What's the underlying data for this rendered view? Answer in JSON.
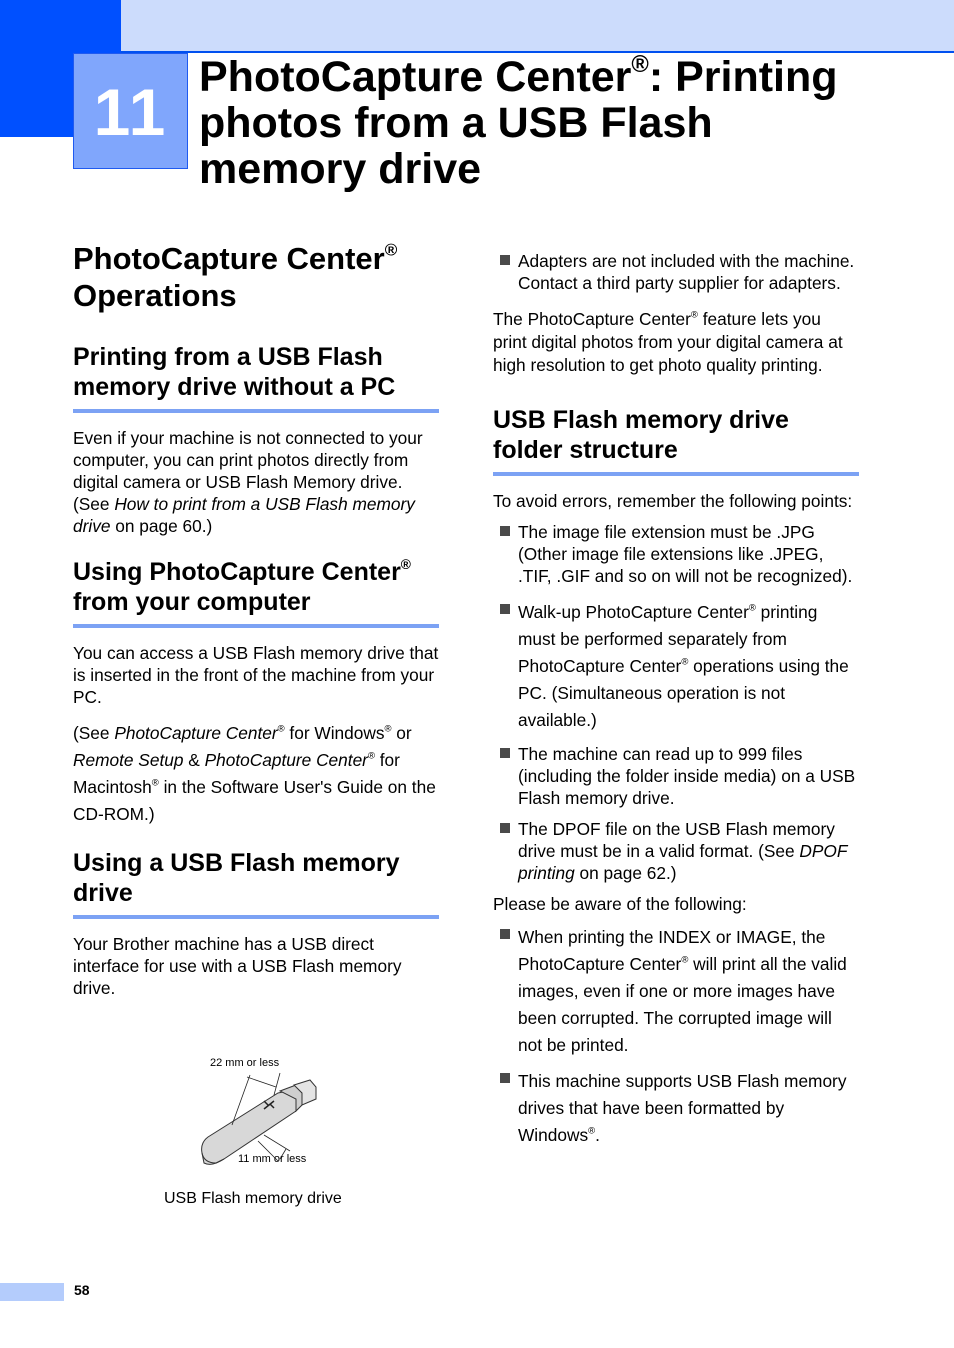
{
  "chapter": {
    "number": "11",
    "title_line1_a": "PhotoCapture Center",
    "title_line1_b": ": Printing",
    "title_line2": "photos from a USB Flash",
    "title_line3": "memory drive",
    "reg": "®"
  },
  "left": {
    "h1_a": "PhotoCapture Center",
    "h1_b": "Operations",
    "section1": {
      "heading_line1": "Printing from a USB Flash",
      "heading_line2": "memory drive without a PC",
      "para_a": "Even if your machine is not connected to your computer, you can print photos directly from digital camera or USB Flash Memory drive. (See ",
      "para_italic": "How to print from a USB Flash memory drive",
      "para_b": " on page 60.)"
    },
    "section2": {
      "heading_a": "Using PhotoCapture Center",
      "heading_b": "from your computer",
      "para1": "You can access a USB Flash memory drive that is inserted in the front of the machine from your PC.",
      "ref_1": "(See ",
      "ref_i1": "PhotoCapture Center",
      "ref_2": " for Windows",
      "ref_3": " or",
      "ref_i2": "Remote Setup",
      "ref_4": " & ",
      "ref_i3": "PhotoCapture Center",
      "ref_5": " for Macintosh",
      "ref_6": " in the Software User's Guide on the CD-ROM.)"
    },
    "section3": {
      "heading_line1": "Using a USB Flash memory",
      "heading_line2": "drive",
      "para": "Your Brother machine has a USB direct interface for use with a USB Flash memory drive."
    },
    "figure": {
      "label_top": "22 mm or less",
      "label_bottom": "11 mm or less",
      "caption": "USB Flash memory drive"
    }
  },
  "right": {
    "bullet_adapters": "Adapters are not included with the machine. Contact a third party supplier for adapters.",
    "feature_a": "The PhotoCapture Center",
    "feature_b": " feature lets you print digital photos from your digital camera at high resolution to get photo quality printing.",
    "section4": {
      "heading_line1": "USB Flash memory drive",
      "heading_line2": "folder structure",
      "intro": "To avoid errors, remember the following points:",
      "b1": "The image file extension must be .JPG (Other image file extensions like .JPEG, .TIF, .GIF and so on will not be recognized).",
      "b2_a": "Walk-up PhotoCapture Center",
      "b2_b": " printing must be performed separately from PhotoCapture Center",
      "b2_c": " operations using the PC. (Simultaneous operation is not available.)",
      "b3": "The machine can read up to 999 files (including the folder inside media) on a USB Flash memory drive.",
      "b4_a": "The DPOF file on the USB Flash memory drive must be in a valid format. (See ",
      "b4_i": "DPOF printing",
      "b4_b": " on page 62.)",
      "aware": "Please be aware of the following:",
      "b5_a": "When printing the INDEX or IMAGE, the PhotoCapture Center",
      "b5_b": " will print all the valid images, even if one or more images have been corrupted. The corrupted image will not be printed.",
      "b6_a": "This machine supports USB Flash memory drives that have been formatted by Windows",
      "b6_b": "."
    }
  },
  "footer": {
    "page_number": "58"
  },
  "colors": {
    "accent": "#0050ff",
    "light_band": "#ccdcfc",
    "rule": "#7ca2f4",
    "chapter_box": "#80a6fc"
  }
}
